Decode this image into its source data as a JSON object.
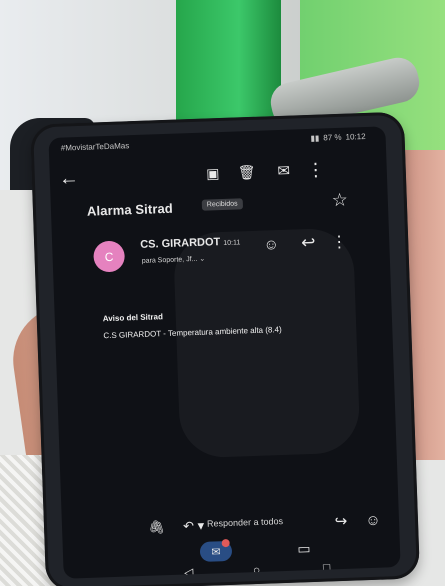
{
  "status_bar": {
    "carrier": "#MovistarTeDaMas",
    "battery": "87 %",
    "time": "10:12"
  },
  "email": {
    "title": "Alarma Sitrad",
    "label": "Recibidos",
    "avatar_letter": "C",
    "sender": "CS. GIRARDOT",
    "time": "10:11",
    "recipients": "para Soporte, Jf...",
    "body_title": "Aviso del Sitrad",
    "body_text": "C.S GIRARDOT - Temperatura ambiente alta (8.4)"
  },
  "footer": {
    "reply_all": "Responder a todos"
  },
  "icons": {
    "back": "arrow-left-icon",
    "archive": "archive-icon",
    "delete": "trash-icon",
    "mail": "mail-icon",
    "more": "more-vertical-icon",
    "star": "star-icon",
    "emoji": "emoji-icon",
    "reply": "reply-icon",
    "forward": "forward-icon",
    "attach": "attachment-icon"
  }
}
